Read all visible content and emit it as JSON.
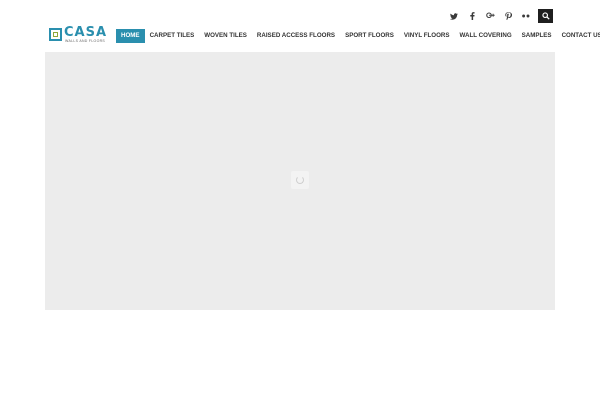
{
  "social_icons": [
    "twitter-icon",
    "facebook-icon",
    "google-plus-icon",
    "pinterest-icon",
    "flickr-icon",
    "email-icon"
  ],
  "search_icon": "search-icon",
  "logo": {
    "word": "CASA",
    "tagline": "WALLS AND FLOORS"
  },
  "nav": {
    "items": [
      "HOME",
      "CARPET TILES",
      "WOVEN TILES",
      "RAISED ACCESS FLOORS",
      "SPORT FLOORS",
      "VINYL FLOORS",
      "WALL COVERING",
      "SAMPLES",
      "CONTACT US"
    ],
    "active": "HOME"
  },
  "colors": {
    "accent": "#2a8fae",
    "logo_inner": "#8ea83a",
    "hero_bg": "#ececec"
  }
}
